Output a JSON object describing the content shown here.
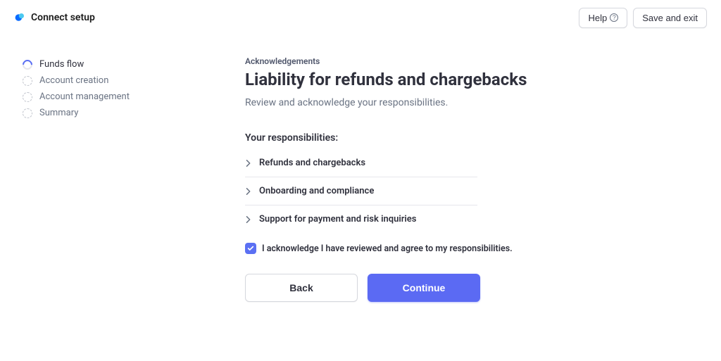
{
  "header": {
    "brand": "Connect setup",
    "help_label": "Help",
    "save_exit_label": "Save and exit"
  },
  "sidebar": {
    "steps": [
      {
        "label": "Funds flow",
        "active": true
      },
      {
        "label": "Account creation",
        "active": false
      },
      {
        "label": "Account management",
        "active": false
      },
      {
        "label": "Summary",
        "active": false
      }
    ]
  },
  "main": {
    "eyebrow": "Acknowledgements",
    "title": "Liability for refunds and chargebacks",
    "subtitle": "Review and acknowledge your responsibilities.",
    "section_label": "Your responsibilities:",
    "items": [
      "Refunds and chargebacks",
      "Onboarding and compliance",
      "Support for payment and risk inquiries"
    ],
    "ack_text": "I acknowledge I have reviewed and agree to my responsibilities.",
    "ack_checked": true,
    "back_label": "Back",
    "continue_label": "Continue"
  },
  "colors": {
    "primary": "#5b6af3"
  }
}
